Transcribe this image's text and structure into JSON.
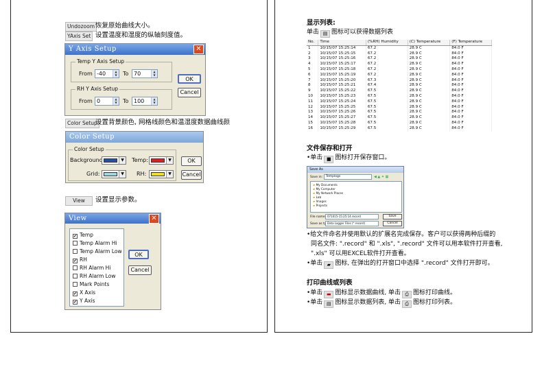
{
  "left": {
    "undozoom": {
      "button": "Undozoom",
      "caption": "恢复原始曲线大小。"
    },
    "yaxis": {
      "button": "YAxis Set",
      "caption": "设置温度和湿度的纵轴刻度值。"
    },
    "yaxis_dialog": {
      "title": "Y Axis Setup",
      "temp_group": "Temp Y Axis Setup",
      "rh_group": "RH Y Axis Setup",
      "from_label": "From",
      "to_label": "To",
      "temp_from": "-40",
      "temp_to": "70",
      "rh_from": "0",
      "rh_to": "100",
      "ok": "OK",
      "cancel": "Cancel"
    },
    "color": {
      "button": "Color Setup",
      "caption": "设置背景颜色, 网格线颜色和温湿度数据曲线颜"
    },
    "color_dialog": {
      "title": "Color Setup",
      "group": "Color Setup",
      "background_label": "Background:",
      "temp_label": "Temp:",
      "grid_label": "Grid:",
      "rh_label": "RH:",
      "ok": "OK",
      "cancel": "Cancel",
      "colors": {
        "background": "#2b4fa0",
        "temp": "#e02020",
        "grid": "#9fd8e0",
        "rh": "#f0e020"
      }
    },
    "view": {
      "button": "View",
      "caption": "设置显示参数。"
    },
    "view_dialog": {
      "title": "View",
      "ok": "OK",
      "cancel": "Cancel",
      "items": [
        {
          "label": "Temp",
          "checked": true
        },
        {
          "label": "Temp Alarm Hi",
          "checked": false
        },
        {
          "label": "Temp Alarm Low",
          "checked": false
        },
        {
          "label": "RH",
          "checked": true
        },
        {
          "label": "RH Alarm Hi",
          "checked": false
        },
        {
          "label": "RH Alarm Low",
          "checked": false
        },
        {
          "label": "Mark Points",
          "checked": false
        },
        {
          "label": "X Axis",
          "checked": true
        },
        {
          "label": "Y Axis",
          "checked": true
        }
      ]
    }
  },
  "right": {
    "list_heading": "显示列表:",
    "list_text_pre": "单击",
    "list_text_post": "图标可以获得数据列表",
    "table": {
      "headers": [
        "No.",
        "Time",
        "(%RH) Humidity",
        "(C) Temperature",
        "(F) Temperature"
      ],
      "rows": [
        [
          "1",
          "10/15/07 15:25:14",
          "67.2",
          "28.9 C",
          "84.0 F"
        ],
        [
          "2",
          "10/15/07 15:25:15",
          "67.2",
          "28.9 C",
          "84.0 F"
        ],
        [
          "3",
          "10/15/07 15:25:16",
          "67.2",
          "28.9 C",
          "84.0 F"
        ],
        [
          "4",
          "10/15/07 15:25:17",
          "67.2",
          "28.9 C",
          "84.0 F"
        ],
        [
          "5",
          "10/15/07 15:25:18",
          "67.2",
          "28.9 C",
          "84.0 F"
        ],
        [
          "6",
          "10/15/07 15:25:19",
          "67.2",
          "28.9 C",
          "84.0 F"
        ],
        [
          "7",
          "10/15/07 15:25:20",
          "67.3",
          "28.9 C",
          "84.0 F"
        ],
        [
          "8",
          "10/15/07 15:25:21",
          "67.4",
          "28.9 C",
          "84.0 F"
        ],
        [
          "9",
          "10/15/07 15:25:22",
          "67.5",
          "28.9 C",
          "84.0 F"
        ],
        [
          "10",
          "10/15/07 15:25:23",
          "67.5",
          "28.9 C",
          "84.0 F"
        ],
        [
          "11",
          "10/15/07 15:25:24",
          "67.5",
          "28.9 C",
          "84.0 F"
        ],
        [
          "12",
          "10/15/07 15:25:25",
          "67.5",
          "28.9 C",
          "84.0 F"
        ],
        [
          "13",
          "10/15/07 15:25:26",
          "67.5",
          "28.9 C",
          "84.0 F"
        ],
        [
          "14",
          "10/15/07 15:25:27",
          "67.5",
          "28.9 C",
          "84.0 F"
        ],
        [
          "15",
          "10/15/07 15:25:28",
          "67.5",
          "28.9 C",
          "84.0 F"
        ],
        [
          "16",
          "10/15/07 15:25:29",
          "67.5",
          "28.9 C",
          "84.0 F"
        ]
      ]
    },
    "save_heading": "文件保存和打开",
    "save_line_pre": "•单击",
    "save_line_post": "图标打开保存窗口。",
    "save_dialog": {
      "title": "Save As",
      "save_in_label": "Save in:",
      "save_in_value": "Templogs",
      "files": [
        "My Documents",
        "My Computer",
        "My Network Places",
        "Lab",
        "Images",
        "Projects"
      ],
      "filename_label": "File name:",
      "filename_value": "071015-15:25:14.record",
      "type_label": "Save as type:",
      "type_value": "Data Logger Files (*.record)",
      "save_btn": "Save",
      "cancel_btn": "Cancel"
    },
    "para1_l1": "•给文件命名并使用默认的扩展名完成保存。客户可以获得两种后缀的",
    "para1_l2": "同名文件: \".record\" 和 \".xls\", \".record\" 文件可以用本软件打开查看,",
    "para1_l3": "\".xls\" 可以用EXCEL软件打开查看。",
    "para2_pre": "•单击",
    "para2_post": "图标, 在弹出的打开窗口中选择 \".record\" 文件打开即可。",
    "print_heading": "打印曲线或列表",
    "print1_pre": "•单击",
    "print1_mid": "图标显示数据曲线, 单击",
    "print1_post": "图标打印曲线。",
    "print2_pre": "•单击",
    "print2_mid": "图标显示数据列表, 单击",
    "print2_post": "图标打印列表。"
  }
}
